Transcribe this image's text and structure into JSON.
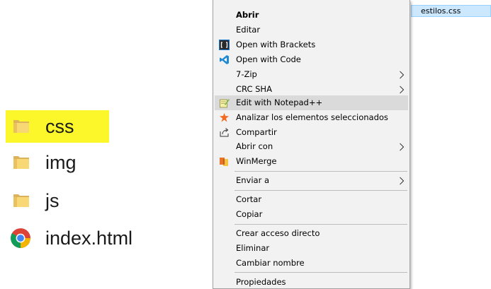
{
  "file_list": {
    "items": [
      {
        "name": "css",
        "icon": "folder-icon"
      },
      {
        "name": "img",
        "icon": "folder-icon"
      },
      {
        "name": "js",
        "icon": "folder-icon"
      },
      {
        "name": "index.html",
        "icon": "chrome-html-icon"
      }
    ],
    "highlight_color": "#fbf72b"
  },
  "selected_file": {
    "name": "estilos.css",
    "background": "#cce8ff"
  },
  "context_menu": {
    "items": [
      {
        "label": "Abrir",
        "bold": true
      },
      {
        "label": "Editar"
      },
      {
        "label": "Open with Brackets",
        "icon": "brackets-icon"
      },
      {
        "label": "Open with Code",
        "icon": "vscode-icon"
      },
      {
        "label": "7-Zip",
        "submenu": true
      },
      {
        "label": "CRC SHA",
        "submenu": true
      },
      {
        "label": "Edit with Notepad++",
        "icon": "notepadpp-icon",
        "hovered": true
      },
      {
        "label": "Analizar los elementos seleccionados",
        "icon": "avast-icon"
      },
      {
        "label": "Compartir",
        "icon": "share-icon"
      },
      {
        "label": "Abrir con",
        "submenu": true
      },
      {
        "label": "WinMerge",
        "icon": "winmerge-icon"
      },
      {
        "label": "Enviar a",
        "submenu": true
      },
      {
        "label": "Cortar"
      },
      {
        "label": "Copiar"
      },
      {
        "label": "Crear acceso directo"
      },
      {
        "label": "Eliminar"
      },
      {
        "label": "Cambiar nombre"
      },
      {
        "label": "Propiedades"
      }
    ],
    "hover_color": "#dadada"
  }
}
